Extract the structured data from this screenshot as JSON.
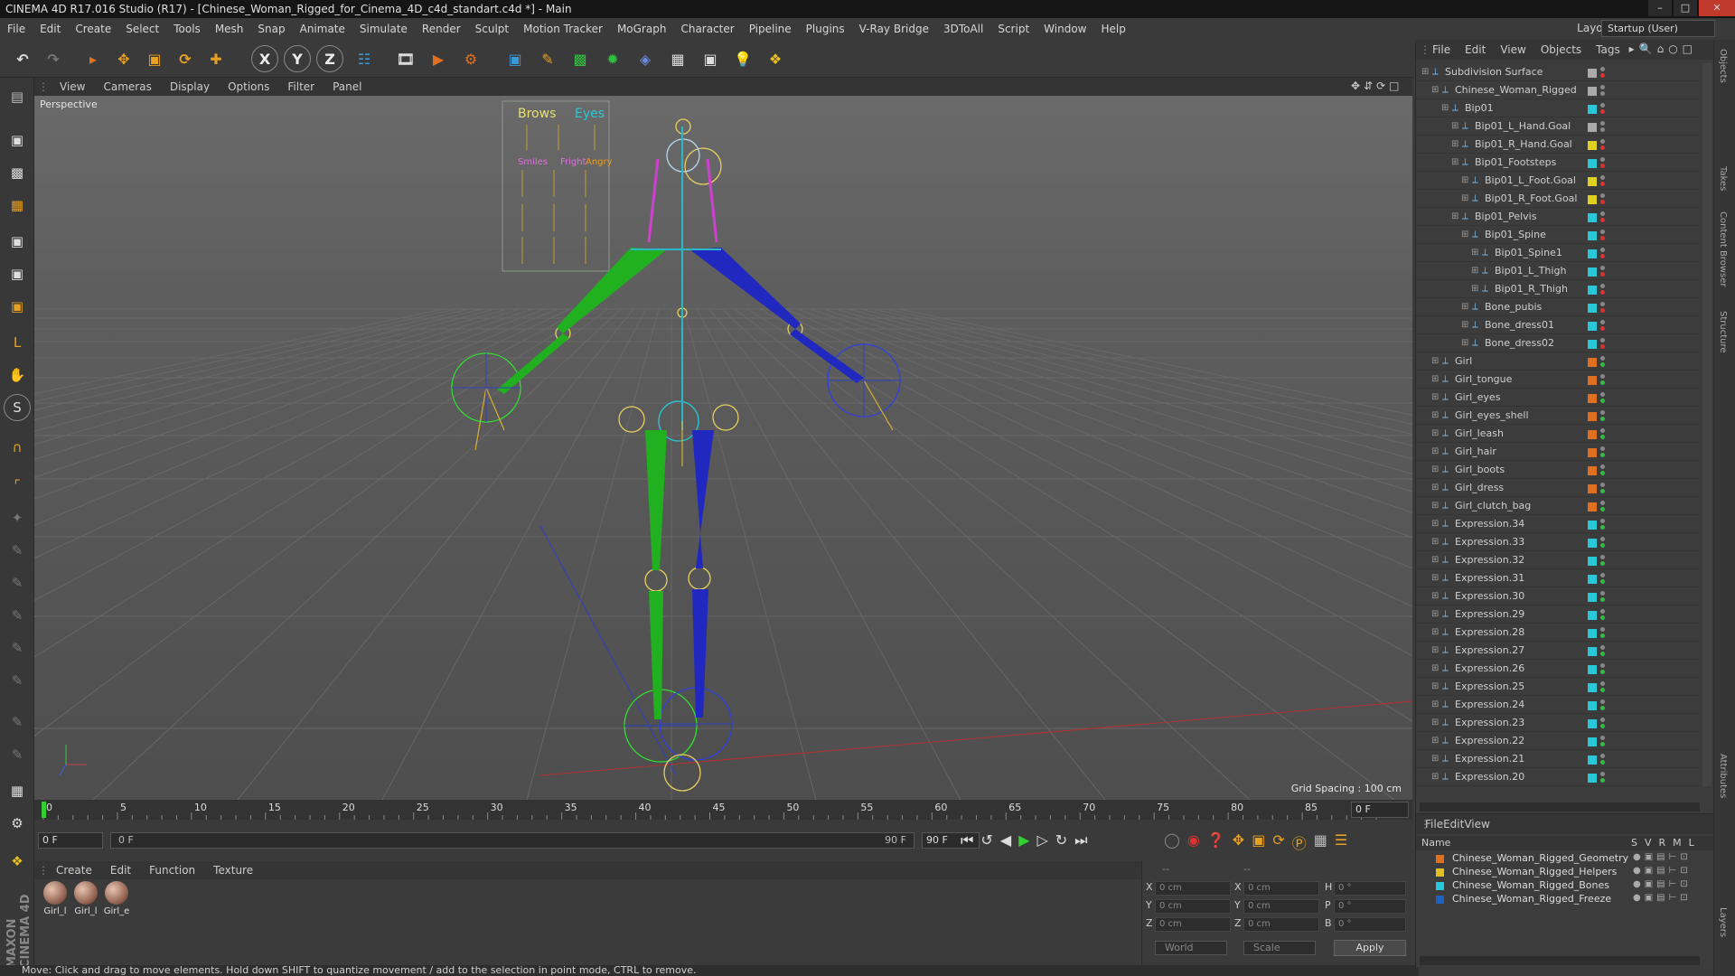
{
  "window": {
    "title": "CINEMA 4D R17.016 Studio (R17) - [Chinese_Woman_Rigged_for_Cinema_4D_c4d_standart.c4d *] - Main"
  },
  "menu": [
    "File",
    "Edit",
    "Create",
    "Select",
    "Tools",
    "Mesh",
    "Snap",
    "Animate",
    "Simulate",
    "Render",
    "Sculpt",
    "Motion Tracker",
    "MoGraph",
    "Character",
    "Pipeline",
    "Plugins",
    "V-Ray Bridge",
    "3DToAll",
    "Script",
    "Window",
    "Help"
  ],
  "layout": {
    "label": "Layout:",
    "value": "Startup (User)"
  },
  "viewport": {
    "menu": [
      "View",
      "Cameras",
      "Display",
      "Options",
      "Filter",
      "Panel"
    ],
    "label": "Perspective",
    "grid_spacing": "Grid Spacing : 100 cm",
    "face_ui": {
      "brows": "Brows",
      "eyes": "Eyes",
      "smiles": "Smiles",
      "fright": "Fright",
      "angry": "Angry"
    }
  },
  "timeline": {
    "ticks": [
      "0",
      "5",
      "10",
      "15",
      "20",
      "25",
      "30",
      "35",
      "40",
      "45",
      "50",
      "55",
      "60",
      "65",
      "70",
      "75",
      "80",
      "85",
      "90"
    ],
    "current_frame": "0 F",
    "start_field": "0 F",
    "slider_left": "0 F",
    "slider_right": "90 F",
    "end_field": "90 F"
  },
  "material_manager": {
    "menu": [
      "Create",
      "Edit",
      "Function",
      "Texture"
    ],
    "materials": [
      "Girl_l",
      "Girl_l",
      "Girl_e"
    ]
  },
  "coords": {
    "header": "--",
    "header2": "--",
    "rows": [
      {
        "a": "X",
        "av": "0 cm",
        "b": "X",
        "bv": "0 cm",
        "c": "H",
        "cv": "0 °"
      },
      {
        "a": "Y",
        "av": "0 cm",
        "b": "Y",
        "bv": "0 cm",
        "c": "P",
        "cv": "0 °"
      },
      {
        "a": "Z",
        "av": "0 cm",
        "b": "Z",
        "bv": "0 cm",
        "c": "B",
        "cv": "0 °"
      }
    ],
    "world": "World",
    "scale": "Scale",
    "apply": "Apply"
  },
  "status": "Move: Click and drag to move elements. Hold down SHIFT to quantize movement / add to the selection in point mode, CTRL to remove.",
  "object_manager": {
    "menu": [
      "File",
      "Edit",
      "View",
      "Objects",
      "Tags"
    ],
    "objects": [
      {
        "name": "Subdivision Surface",
        "indent": 0,
        "tag": "#aaaaaa",
        "dot": "#e03030"
      },
      {
        "name": "Chinese_Woman_Rigged",
        "indent": 1,
        "tag": "#aaaaaa",
        "dot": "#888888"
      },
      {
        "name": "Bip01",
        "indent": 2,
        "tag": "#28c8d8",
        "dot": "#e03030"
      },
      {
        "name": "Bip01_L_Hand.Goal",
        "indent": 3,
        "tag": "#aaaaaa",
        "dot": "#888888"
      },
      {
        "name": "Bip01_R_Hand.Goal",
        "indent": 3,
        "tag": "#e0d020",
        "dot": "#e03030"
      },
      {
        "name": "Bip01_Footsteps",
        "indent": 3,
        "tag": "#28c8d8",
        "dot": "#e03030"
      },
      {
        "name": "Bip01_L_Foot.Goal",
        "indent": 4,
        "tag": "#e0d020",
        "dot": "#e03030"
      },
      {
        "name": "Bip01_R_Foot.Goal",
        "indent": 4,
        "tag": "#e0d020",
        "dot": "#e03030"
      },
      {
        "name": "Bip01_Pelvis",
        "indent": 3,
        "tag": "#28c8d8",
        "dot": "#e03030"
      },
      {
        "name": "Bip01_Spine",
        "indent": 4,
        "tag": "#28c8d8",
        "dot": "#e03030"
      },
      {
        "name": "Bip01_Spine1",
        "indent": 5,
        "tag": "#28c8d8",
        "dot": "#e03030"
      },
      {
        "name": "Bip01_L_Thigh",
        "indent": 5,
        "tag": "#28c8d8",
        "dot": "#e03030"
      },
      {
        "name": "Bip01_R_Thigh",
        "indent": 5,
        "tag": "#28c8d8",
        "dot": "#e03030"
      },
      {
        "name": "Bone_pubis",
        "indent": 4,
        "tag": "#28c8d8",
        "dot": "#e03030"
      },
      {
        "name": "Bone_dress01",
        "indent": 4,
        "tag": "#28c8d8",
        "dot": "#e03030"
      },
      {
        "name": "Bone_dress02",
        "indent": 4,
        "tag": "#28c8d8",
        "dot": "#e03030"
      },
      {
        "name": "Girl",
        "indent": 1,
        "tag": "#e07020",
        "dot": "#30c040"
      },
      {
        "name": "Girl_tongue",
        "indent": 1,
        "tag": "#e07020",
        "dot": "#30c040"
      },
      {
        "name": "Girl_eyes",
        "indent": 1,
        "tag": "#e07020",
        "dot": "#30c040"
      },
      {
        "name": "Girl_eyes_shell",
        "indent": 1,
        "tag": "#e07020",
        "dot": "#30c040"
      },
      {
        "name": "Girl_leash",
        "indent": 1,
        "tag": "#e07020",
        "dot": "#30c040"
      },
      {
        "name": "Girl_hair",
        "indent": 1,
        "tag": "#e07020",
        "dot": "#30c040"
      },
      {
        "name": "Girl_boots",
        "indent": 1,
        "tag": "#e07020",
        "dot": "#30c040"
      },
      {
        "name": "Girl_dress",
        "indent": 1,
        "tag": "#e07020",
        "dot": "#30c040"
      },
      {
        "name": "Girl_clutch_bag",
        "indent": 1,
        "tag": "#e07020",
        "dot": "#30c040"
      },
      {
        "name": "Expression.34",
        "indent": 1,
        "tag": "#28c8d8",
        "dot": "#30c040"
      },
      {
        "name": "Expression.33",
        "indent": 1,
        "tag": "#28c8d8",
        "dot": "#30c040"
      },
      {
        "name": "Expression.32",
        "indent": 1,
        "tag": "#28c8d8",
        "dot": "#30c040"
      },
      {
        "name": "Expression.31",
        "indent": 1,
        "tag": "#28c8d8",
        "dot": "#30c040"
      },
      {
        "name": "Expression.30",
        "indent": 1,
        "tag": "#28c8d8",
        "dot": "#30c040"
      },
      {
        "name": "Expression.29",
        "indent": 1,
        "tag": "#28c8d8",
        "dot": "#30c040"
      },
      {
        "name": "Expression.28",
        "indent": 1,
        "tag": "#28c8d8",
        "dot": "#30c040"
      },
      {
        "name": "Expression.27",
        "indent": 1,
        "tag": "#28c8d8",
        "dot": "#30c040"
      },
      {
        "name": "Expression.26",
        "indent": 1,
        "tag": "#28c8d8",
        "dot": "#30c040"
      },
      {
        "name": "Expression.25",
        "indent": 1,
        "tag": "#28c8d8",
        "dot": "#30c040"
      },
      {
        "name": "Expression.24",
        "indent": 1,
        "tag": "#28c8d8",
        "dot": "#30c040"
      },
      {
        "name": "Expression.23",
        "indent": 1,
        "tag": "#28c8d8",
        "dot": "#30c040"
      },
      {
        "name": "Expression.22",
        "indent": 1,
        "tag": "#28c8d8",
        "dot": "#30c040"
      },
      {
        "name": "Expression.21",
        "indent": 1,
        "tag": "#28c8d8",
        "dot": "#30c040"
      },
      {
        "name": "Expression.20",
        "indent": 1,
        "tag": "#28c8d8",
        "dot": "#30c040"
      }
    ]
  },
  "layer_manager": {
    "menu": [
      "File",
      "Edit",
      "View"
    ],
    "col_name": "Name",
    "cols": [
      "S",
      "V",
      "R",
      "M",
      "L"
    ],
    "layers": [
      {
        "name": "Chinese_Woman_Rigged_Geometry",
        "color": "#e07020"
      },
      {
        "name": "Chinese_Woman_Rigged_Helpers",
        "color": "#e0c020"
      },
      {
        "name": "Chinese_Woman_Rigged_Bones",
        "color": "#28c8d8"
      },
      {
        "name": "Chinese_Woman_Rigged_Freeze",
        "color": "#2060c0"
      }
    ]
  },
  "right_tabs": [
    "Objects",
    "Takes",
    "Content Browser",
    "Structure",
    "Attributes",
    "Layers"
  ]
}
